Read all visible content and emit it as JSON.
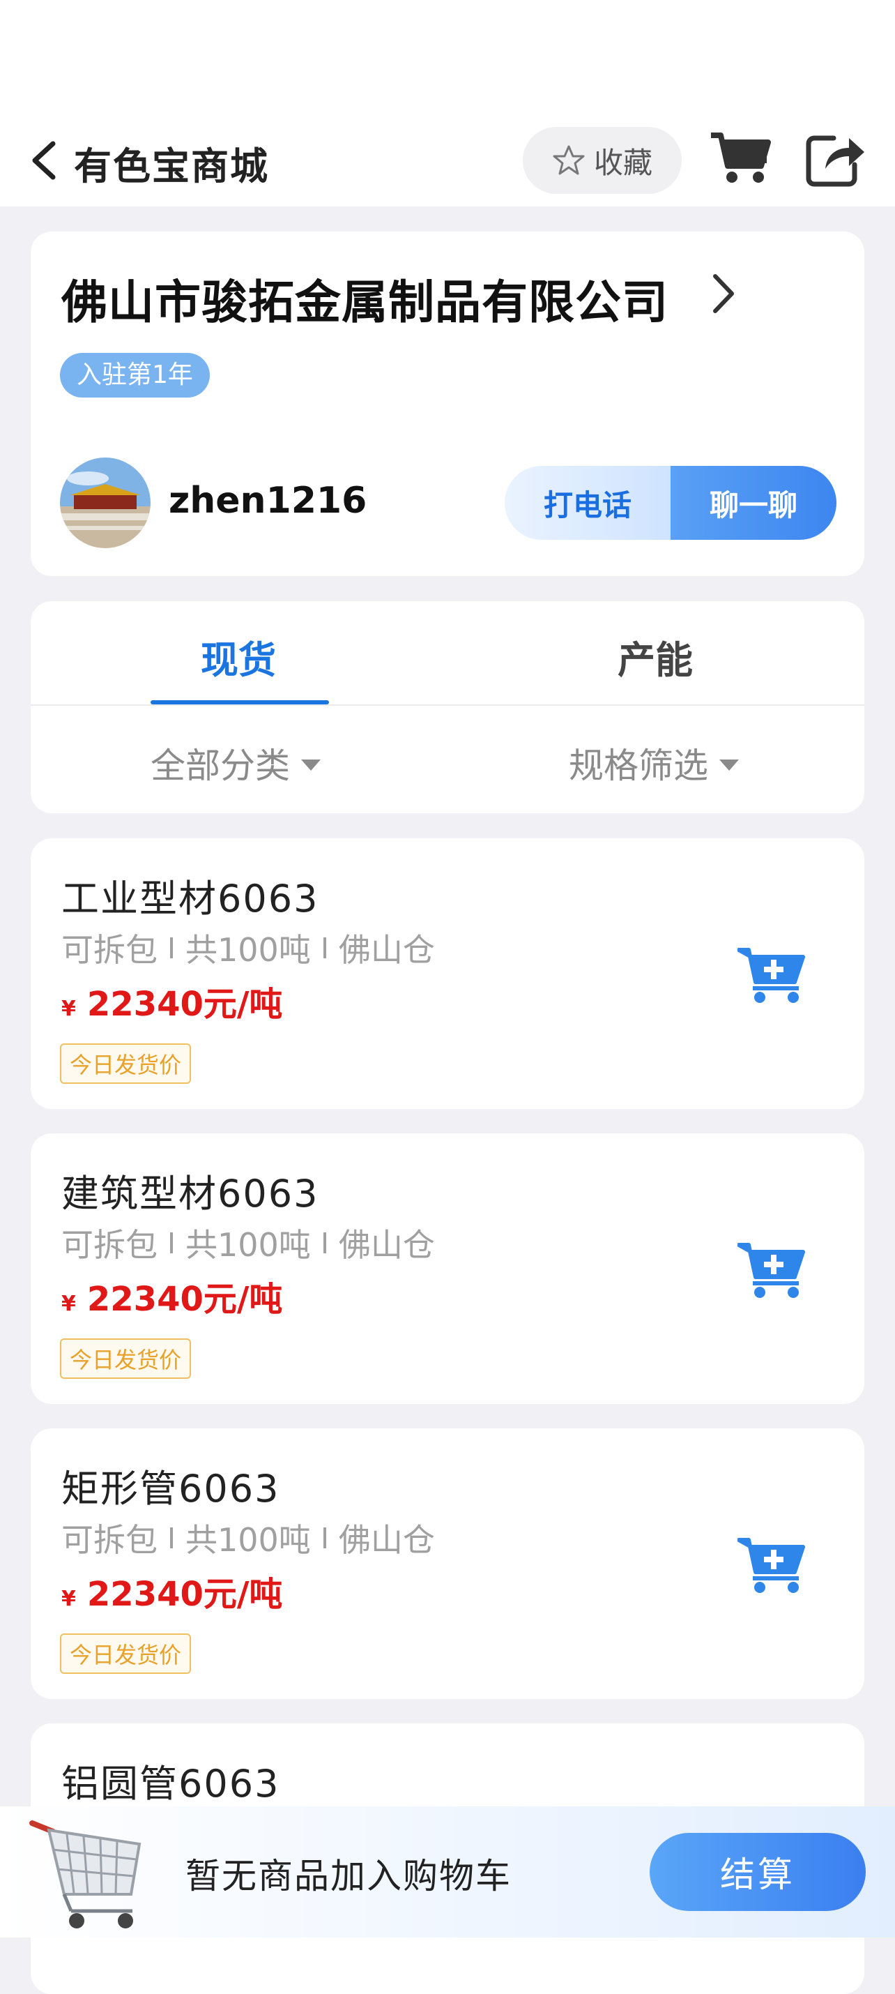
{
  "header": {
    "title": "有色宝商城",
    "favorite_label": "收藏"
  },
  "store": {
    "name": "佛山市骏拓金属制品有限公司",
    "badge": "入驻第1年",
    "username": "zhen1216",
    "call_label": "打电话",
    "chat_label": "聊一聊"
  },
  "tabs": {
    "spot": "现货",
    "capacity": "产能",
    "active": "现货",
    "filter_category": "全部分类",
    "filter_spec": "规格筛选"
  },
  "products": [
    {
      "name": "工业型材6063",
      "split": "可拆包",
      "qty": "共100吨",
      "warehouse": "佛山仓",
      "currency": "¥",
      "price": "22340元/吨",
      "tag": "今日发货价"
    },
    {
      "name": "建筑型材6063",
      "split": "可拆包",
      "qty": "共100吨",
      "warehouse": "佛山仓",
      "currency": "¥",
      "price": "22340元/吨",
      "tag": "今日发货价"
    },
    {
      "name": "矩形管6063",
      "split": "可拆包",
      "qty": "共100吨",
      "warehouse": "佛山仓",
      "currency": "¥",
      "price": "22340元/吨",
      "tag": "今日发货价"
    },
    {
      "name": "铝圆管6063"
    }
  ],
  "bottom_bar": {
    "empty_text": "暂无商品加入购物车",
    "checkout_label": "结算"
  },
  "colors": {
    "accent_blue": "#1a75e0",
    "price_red": "#e01818",
    "tag_orange": "#e8a22a",
    "page_bg": "#f0f0f5"
  },
  "icons": [
    "back-arrow-icon",
    "star-icon",
    "cart-icon",
    "share-icon",
    "chevron-right-icon",
    "caret-down-icon",
    "add-to-cart-icon",
    "shopping-cart-illustration"
  ]
}
